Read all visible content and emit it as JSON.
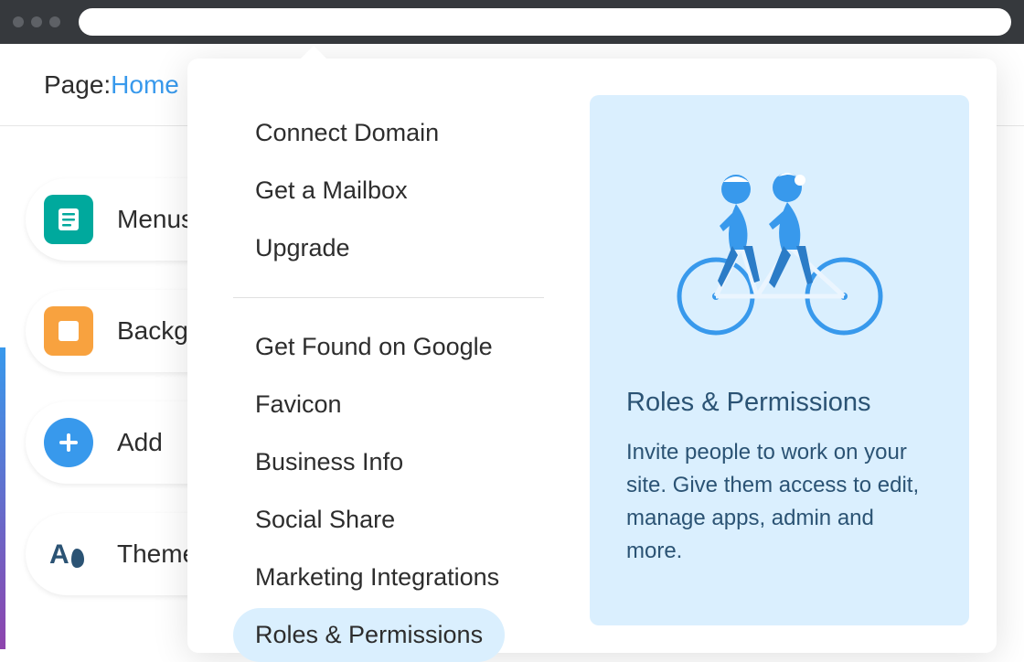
{
  "page": {
    "label": "Page: ",
    "name": "Home"
  },
  "sidebar": {
    "items": [
      {
        "label": "Menus & Pages"
      },
      {
        "label": "Background"
      },
      {
        "label": "Add"
      },
      {
        "label": "Theme Manager"
      }
    ]
  },
  "dropdown": {
    "group1": [
      "Connect Domain",
      "Get a Mailbox",
      "Upgrade"
    ],
    "group2": [
      "Get Found on Google",
      "Favicon",
      "Business Info",
      "Social Share",
      "Marketing Integrations",
      "Roles & Permissions"
    ],
    "selected": "Roles & Permissions"
  },
  "info": {
    "title": "Roles & Permissions",
    "description": "Invite people to work on your site. Give them access to edit, manage apps, admin and more."
  }
}
